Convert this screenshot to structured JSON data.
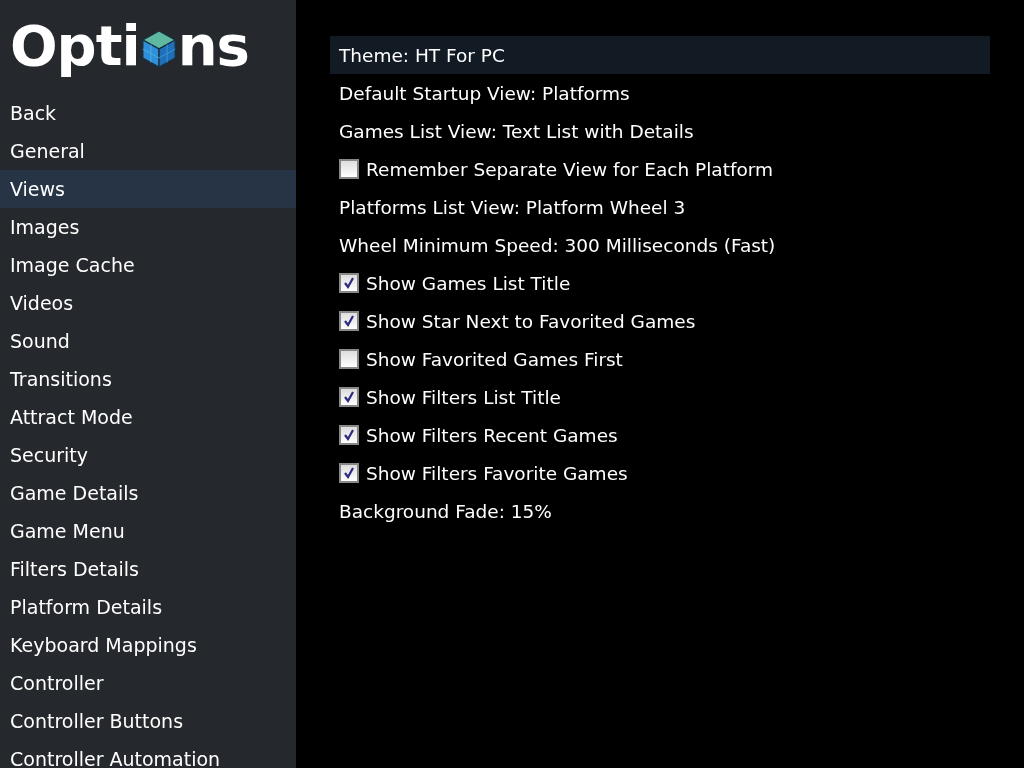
{
  "title": {
    "before_icon": "Opti",
    "after_icon": "ns"
  },
  "sidebar": {
    "items": [
      {
        "label": "Back",
        "selected": false
      },
      {
        "label": "General",
        "selected": false
      },
      {
        "label": "Views",
        "selected": true
      },
      {
        "label": "Images",
        "selected": false
      },
      {
        "label": "Image Cache",
        "selected": false
      },
      {
        "label": "Videos",
        "selected": false
      },
      {
        "label": "Sound",
        "selected": false
      },
      {
        "label": "Transitions",
        "selected": false
      },
      {
        "label": "Attract Mode",
        "selected": false
      },
      {
        "label": "Security",
        "selected": false
      },
      {
        "label": "Game Details",
        "selected": false
      },
      {
        "label": "Game Menu",
        "selected": false
      },
      {
        "label": "Filters Details",
        "selected": false
      },
      {
        "label": "Platform Details",
        "selected": false
      },
      {
        "label": "Keyboard Mappings",
        "selected": false
      },
      {
        "label": "Controller",
        "selected": false
      },
      {
        "label": "Controller Buttons",
        "selected": false
      },
      {
        "label": "Controller Automation",
        "selected": false
      }
    ]
  },
  "settings": [
    {
      "kind": "value",
      "label": "Theme: HT For PC",
      "selected": true
    },
    {
      "kind": "value",
      "label": "Default Startup View: Platforms",
      "selected": false
    },
    {
      "kind": "value",
      "label": "Games List View: Text List with Details",
      "selected": false
    },
    {
      "kind": "checkbox",
      "label": "Remember Separate View for Each Platform",
      "checked": false,
      "selected": false
    },
    {
      "kind": "value",
      "label": "Platforms List View: Platform Wheel 3",
      "selected": false
    },
    {
      "kind": "value",
      "label": "Wheel Minimum Speed: 300 Milliseconds (Fast)",
      "selected": false
    },
    {
      "kind": "checkbox",
      "label": "Show Games List Title",
      "checked": true,
      "selected": false
    },
    {
      "kind": "checkbox",
      "label": "Show Star Next to Favorited Games",
      "checked": true,
      "selected": false
    },
    {
      "kind": "checkbox",
      "label": "Show Favorited Games First",
      "checked": false,
      "selected": false
    },
    {
      "kind": "checkbox",
      "label": "Show Filters List Title",
      "checked": true,
      "selected": false
    },
    {
      "kind": "checkbox",
      "label": "Show Filters Recent Games",
      "checked": true,
      "selected": false
    },
    {
      "kind": "checkbox",
      "label": "Show Filters Favorite Games",
      "checked": true,
      "selected": false
    },
    {
      "kind": "value",
      "label": "Background Fade: 15%",
      "selected": false
    }
  ]
}
